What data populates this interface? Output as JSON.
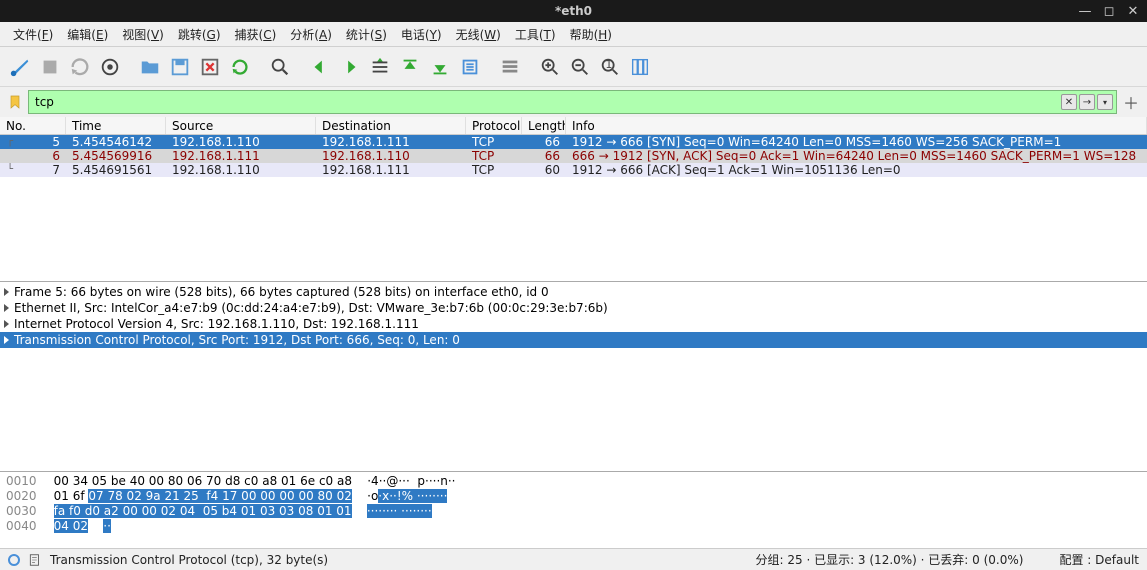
{
  "title": "*eth0",
  "menu": [
    "文件(F)",
    "编辑(E)",
    "视图(V)",
    "跳转(G)",
    "捕获(C)",
    "分析(A)",
    "统计(S)",
    "电话(Y)",
    "无线(W)",
    "工具(T)",
    "帮助(H)"
  ],
  "filter_value": "tcp",
  "cols": {
    "no": "No.",
    "time": "Time",
    "src": "Source",
    "dst": "Destination",
    "proto": "Protocol",
    "len": "Length",
    "info": "Info"
  },
  "rows": [
    {
      "cls": "row-sel",
      "no": "5",
      "time": "5.454546142",
      "src": "192.168.1.110",
      "dst": "192.168.1.111",
      "proto": "TCP",
      "len": "66",
      "info": "1912 → 666 [SYN] Seq=0 Win=64240 Len=0 MSS=1460 WS=256 SACK_PERM=1"
    },
    {
      "cls": "row-gray",
      "no": "6",
      "time": "5.454569916",
      "src": "192.168.1.111",
      "dst": "192.168.1.110",
      "proto": "TCP",
      "len": "66",
      "info": "666 → 1912 [SYN, ACK] Seq=0 Ack=1 Win=64240 Len=0 MSS=1460 SACK_PERM=1 WS=128"
    },
    {
      "cls": "row-lav",
      "no": "7",
      "time": "5.454691561",
      "src": "192.168.1.110",
      "dst": "192.168.1.111",
      "proto": "TCP",
      "len": "60",
      "info": "1912 → 666 [ACK] Seq=1 Ack=1 Win=1051136 Len=0"
    }
  ],
  "details": [
    {
      "sel": false,
      "t": "Frame 5: 66 bytes on wire (528 bits), 66 bytes captured (528 bits) on interface eth0, id 0"
    },
    {
      "sel": false,
      "t": "Ethernet II, Src: IntelCor_a4:e7:b9 (0c:dd:24:a4:e7:b9), Dst: VMware_3e:b7:6b (00:0c:29:3e:b7:6b)"
    },
    {
      "sel": false,
      "t": "Internet Protocol Version 4, Src: 192.168.1.110, Dst: 192.168.1.111"
    },
    {
      "sel": true,
      "t": "Transmission Control Protocol, Src Port: 1912, Dst Port: 666, Seq: 0, Len: 0"
    }
  ],
  "hex": [
    {
      "off": "0010",
      "l": "00 34 05 be 40 00 80 06",
      "r": " 70 d8 c0 a8 01 6e c0 a8",
      "al": " ·4··@··· ",
      "ar": " p····n··",
      "hl": ""
    },
    {
      "off": "0020",
      "l": "01 6f ",
      "hlh": "07 78 02 9a 21 25  f4 17 00 00 00 00 80 02",
      "al": " ·o",
      "ahl": "·x··!% ········",
      "r": "",
      "ar": ""
    },
    {
      "off": "0030",
      "hlh": "fa f0 d0 a2 00 00 02 04  05 b4 01 03 03 08 01 01",
      "al": " ",
      "ahl": "········ ········",
      "l": "",
      "r": "",
      "ar": ""
    },
    {
      "off": "0040",
      "hlh": "04 02",
      "al": " ",
      "ahl": "··",
      "l": "",
      "r": "",
      "ar": ""
    }
  ],
  "status_main": "Transmission Control Protocol (tcp), 32 byte(s)",
  "status_pkts": "分组: 25 · 已显示: 3 (12.0%) · 已丢弃: 0 (0.0%)",
  "status_profile": "配置 : Default"
}
